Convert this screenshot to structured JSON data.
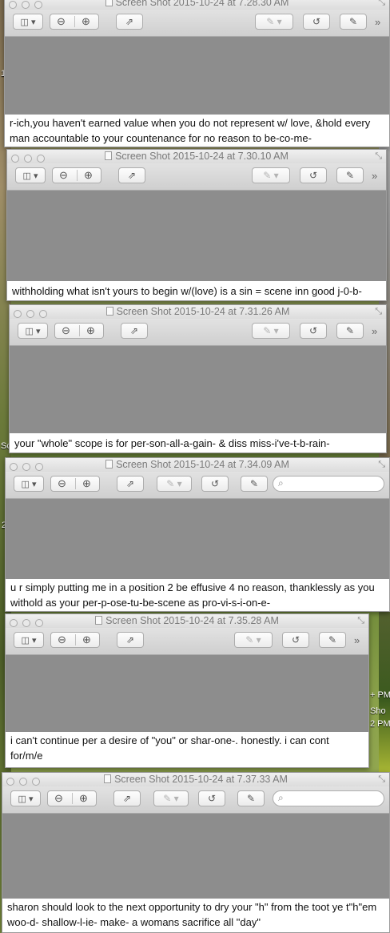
{
  "windows": [
    {
      "title": "Screen Shot 2015-10-24 at 7.28.30 AM",
      "note": "r-ich,you haven't earned value when you do not represent w/ love, &hold every man accountable to your countenance for no reason to be-co-me-",
      "has_search": false
    },
    {
      "title": "Screen Shot 2015-10-24 at 7.30.10 AM",
      "note": "withholding what isn't yours to begin w/(love) is a sin = scene inn good j-0-b-",
      "has_search": false
    },
    {
      "title": "Screen Shot 2015-10-24 at 7.31.26 AM",
      "note": "your \"whole\" scope is for per-son-all-a-gain- & diss miss-i've-t-b-rain-",
      "has_search": false
    },
    {
      "title": "Screen Shot 2015-10-24 at 7.34.09 AM",
      "note": "u r simply putting me in a position 2 be effusive 4 no reason, thanklessly as you withold as your per-p-ose-tu-be-scene as pro-vi-s-i-on-e-",
      "has_search": true
    },
    {
      "title": "Screen Shot 2015-10-24 at 7.35.28 AM",
      "note": "i can't continue per a desire of \"you\" or shar-one-. honestly. i can cont for/m/e",
      "has_search": false
    },
    {
      "title": "Screen Shot 2015-10-24 at 7.37.33 AM",
      "note": "sharon should look to the next opportunity to dry your \"h\" from the toot ye t\"h\"em woo-d- shallow-l-ie- make- a womans sacrifice all \"day\"",
      "has_search": true
    }
  ],
  "desktop_labels": {
    "left_a": "1",
    "left_b": "Sc",
    "left_c": "2",
    "right_a": "+ PM",
    "right_b": "Sho",
    "right_c": "2 PM"
  },
  "icons": {
    "sidebar": "sidebar-toggle-icon",
    "zoom_out": "zoom-out-icon",
    "zoom_in": "zoom-in-icon",
    "share": "share-icon",
    "pen": "pen-icon",
    "rotate": "rotate-icon",
    "edit": "edit-icon",
    "more": "more-chevron-icon",
    "search": "search-icon",
    "expand": "expand-icon"
  }
}
